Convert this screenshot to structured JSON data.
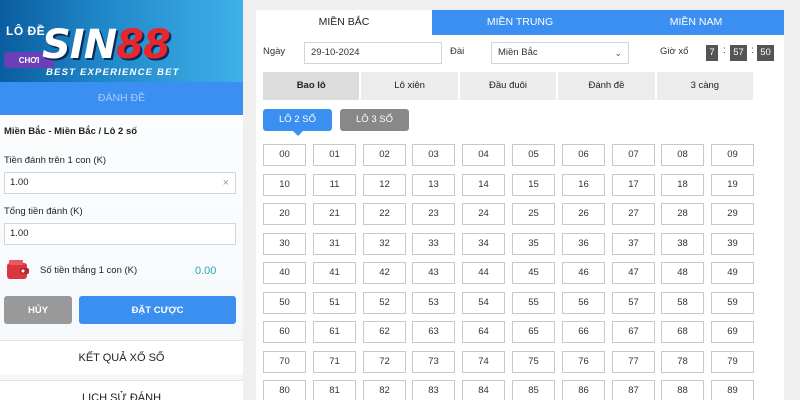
{
  "banner": {
    "text": "LÔ ĐỀ",
    "chip": "CHƠI",
    "logo_main": "SIN",
    "logo_accent": "88",
    "logo_sub": "BEST EXPERIENCE BET"
  },
  "left": {
    "header_label": "ĐÁNH ĐỀ",
    "breadcrumb": "Miền Bắc - Miền Bắc / Lô 2 số",
    "stake_label": "Tiền đánh trên 1 con (K)",
    "stake_value": "1.00",
    "stake_clear": "×",
    "total_label": "Tổng tiền đánh (K)",
    "total_value": "1.00",
    "win_label": "Số tiền thắng 1 con (K)",
    "win_value": "0.00",
    "cancel_label": "HỦY",
    "place_label": "ĐẶT CƯỢC",
    "results_link": "KẾT QUẢ XỔ SỐ",
    "history_link": "LỊCH SỬ ĐÁNH"
  },
  "region_tabs": [
    "MIỀN BẮC",
    "MIỀN TRUNG",
    "MIỀN NAM"
  ],
  "filter": {
    "date_label": "Ngày",
    "date_value": "29-10-2024",
    "dai_label": "Đài",
    "dai_value": "Miền Bắc",
    "clock_label": "Giờ xổ",
    "clock_h": "7",
    "clock_m": "57",
    "clock_s": "50"
  },
  "bet_tabs": [
    "Bao lô",
    "Lô xiên",
    "Đầu đuôi",
    "Đánh đề",
    "3 càng"
  ],
  "sub_tabs": [
    "LÔ 2 SỐ",
    "LÔ 3 SỐ"
  ],
  "numbers": [
    "00",
    "01",
    "02",
    "03",
    "04",
    "05",
    "06",
    "07",
    "08",
    "09",
    "10",
    "11",
    "12",
    "13",
    "14",
    "15",
    "16",
    "17",
    "18",
    "19",
    "20",
    "21",
    "22",
    "23",
    "24",
    "25",
    "26",
    "27",
    "28",
    "29",
    "30",
    "31",
    "32",
    "33",
    "34",
    "35",
    "36",
    "37",
    "38",
    "39",
    "40",
    "41",
    "42",
    "43",
    "44",
    "45",
    "46",
    "47",
    "48",
    "49",
    "50",
    "51",
    "52",
    "53",
    "54",
    "55",
    "56",
    "57",
    "58",
    "59",
    "60",
    "61",
    "62",
    "63",
    "64",
    "65",
    "66",
    "67",
    "68",
    "69",
    "70",
    "71",
    "72",
    "73",
    "74",
    "75",
    "76",
    "77",
    "78",
    "79",
    "80",
    "81",
    "82",
    "83",
    "84",
    "85",
    "86",
    "87",
    "88",
    "89"
  ],
  "colors": {
    "primary": "#3a8ff0",
    "inactive": "#888888",
    "win_value": "#2aa7b8"
  }
}
